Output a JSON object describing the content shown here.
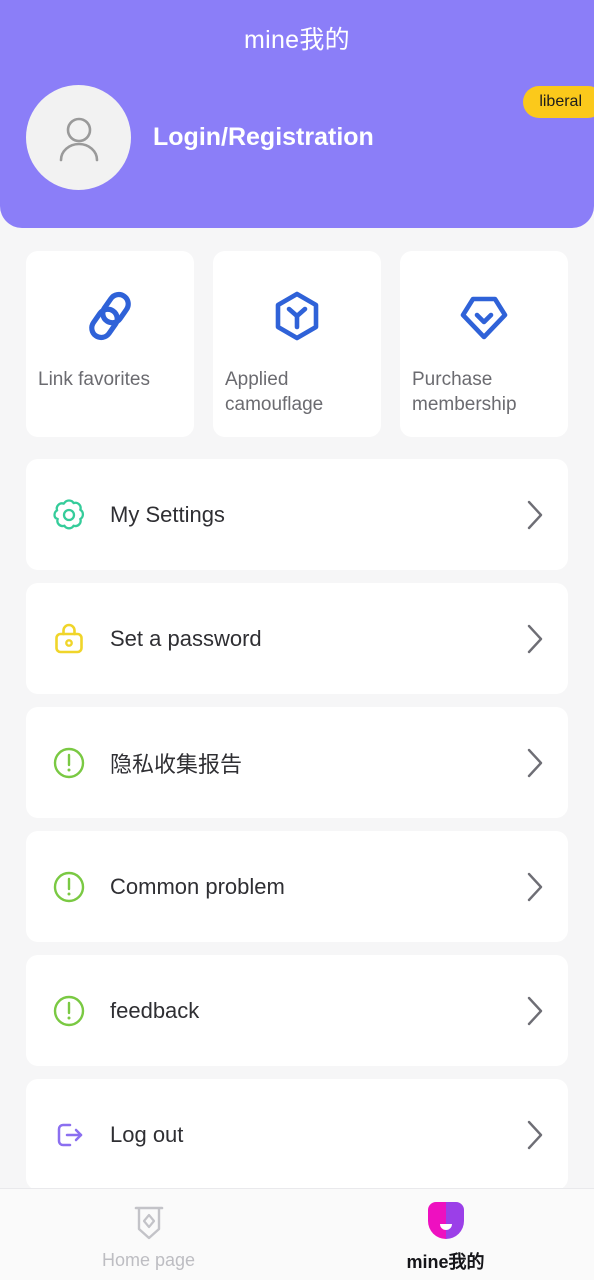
{
  "header": {
    "title": "mine我的",
    "login_label": "Login/Registration",
    "badge_label": "liberal",
    "avatar_icon": "user-avatar-icon",
    "background_color": "#8b7ef8",
    "badge_color": "#fbc91b"
  },
  "cards": [
    {
      "label": "Link favorites",
      "icon": "chain-link-icon",
      "color": "#2f62d8"
    },
    {
      "label": "Applied camouflage",
      "icon": "hexagon-y-icon",
      "color": "#2f62d8"
    },
    {
      "label": "Purchase membership",
      "icon": "membership-diamond-icon",
      "color": "#2f62d8"
    }
  ],
  "list": [
    {
      "label": "My Settings",
      "icon": "gear-icon",
      "color": "#35cc9a",
      "chevron": "chevron-right-icon"
    },
    {
      "label": "Set a password",
      "icon": "lock-icon",
      "color": "#f0d52a",
      "chevron": "chevron-right-icon"
    },
    {
      "label": "隐私收集报告",
      "icon": "alert-circle-icon",
      "color": "#7ac943",
      "chevron": "chevron-right-icon"
    },
    {
      "label": "Common problem",
      "icon": "alert-circle-icon",
      "color": "#7ac943",
      "chevron": "chevron-right-icon"
    },
    {
      "label": "feedback",
      "icon": "alert-circle-icon",
      "color": "#7ac943",
      "chevron": "chevron-right-icon"
    },
    {
      "label": "Log out",
      "icon": "logout-icon",
      "color": "#8b6ff0",
      "chevron": "chevron-right-icon"
    }
  ],
  "tabbar": {
    "tabs": [
      {
        "label": "Home page",
        "icon": "banner-diamond-icon",
        "active": false
      },
      {
        "label": "mine我的",
        "icon": "profile-circle-icon",
        "active": true
      }
    ]
  }
}
